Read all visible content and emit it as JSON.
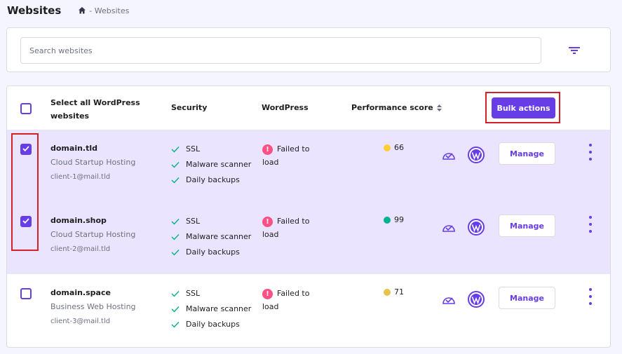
{
  "header": {
    "title": "Websites",
    "breadcrumb_current": "Websites"
  },
  "search": {
    "placeholder": "Search websites",
    "value": ""
  },
  "table": {
    "select_all_label": "Select all WordPress websites",
    "columns": {
      "security": "Security",
      "wordpress": "WordPress",
      "performance": "Performance score"
    },
    "bulk_actions_label": "Bulk actions",
    "rows": [
      {
        "domain": "domain.tld",
        "plan": "Cloud Startup Hosting",
        "email": "client-1@mail.tld",
        "selected": true,
        "security": [
          "SSL",
          "Malware scanner",
          "Daily backups"
        ],
        "wp_status": "Failed to load",
        "perf_score": "66",
        "perf_color": "#ffcd35",
        "manage_label": "Manage"
      },
      {
        "domain": "domain.shop",
        "plan": "Cloud Startup Hosting",
        "email": "client-2@mail.tld",
        "selected": true,
        "security": [
          "SSL",
          "Malware scanner",
          "Daily backups"
        ],
        "wp_status": "Failed to load",
        "perf_score": "99",
        "perf_color": "#00b090",
        "manage_label": "Manage"
      },
      {
        "domain": "domain.space",
        "plan": "Business Web Hosting",
        "email": "client-3@mail.tld",
        "selected": false,
        "security": [
          "SSL",
          "Malware scanner",
          "Daily backups"
        ],
        "wp_status": "Failed to load",
        "perf_score": "71",
        "perf_color": "#e6c34a",
        "manage_label": "Manage"
      }
    ]
  },
  "colors": {
    "accent": "#673de6",
    "highlight": "#d42127",
    "error": "#fc5185",
    "check": "#00b090"
  },
  "icons": {
    "breadcrumb": "home-icon",
    "filter": "filter-icon",
    "sort": "sort-icon",
    "security": "checkmark-icon",
    "wp_status": "error-icon",
    "row_action_1": "speed-icon",
    "row_action_2": "wordpress-icon",
    "row_menu": "kebab-menu-icon"
  }
}
